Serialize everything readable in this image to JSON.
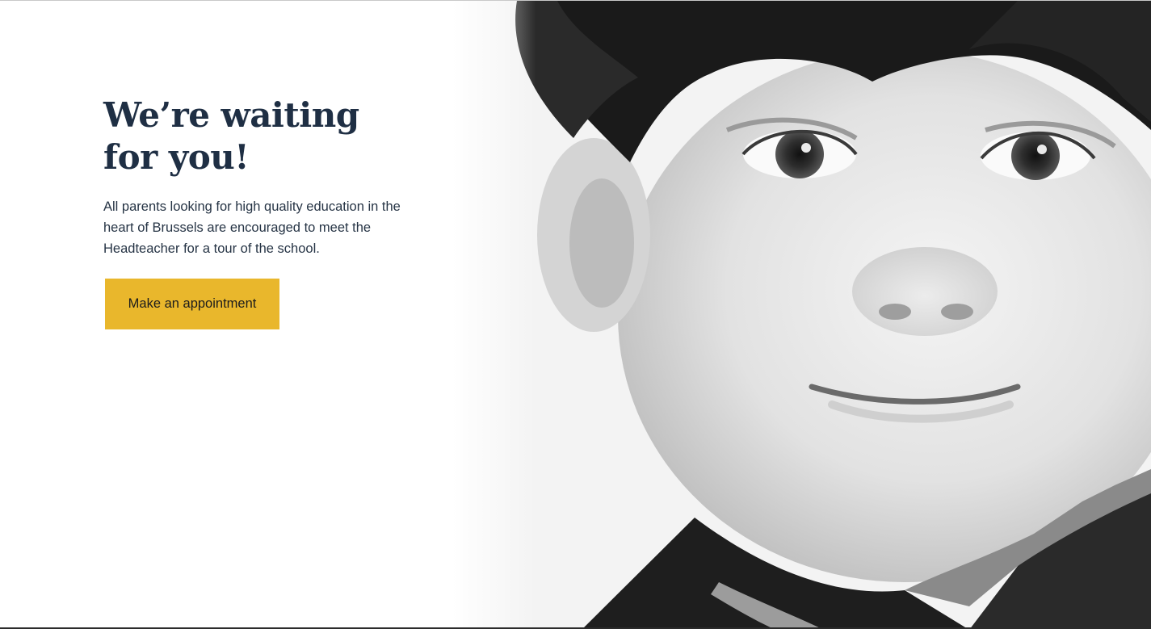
{
  "hero": {
    "headline_line1": "We’re waiting",
    "headline_line2": "for you!",
    "lead": "All parents looking for high quality education in the heart of Brussels are encouraged to meet the Headteacher for a tour of the school.",
    "cta_label": "Make an appointment"
  },
  "colors": {
    "accent": "#e9b72c",
    "heading": "#1f2f44",
    "text": "#263445"
  },
  "icons": {
    "photo": "child-portrait-photo"
  }
}
